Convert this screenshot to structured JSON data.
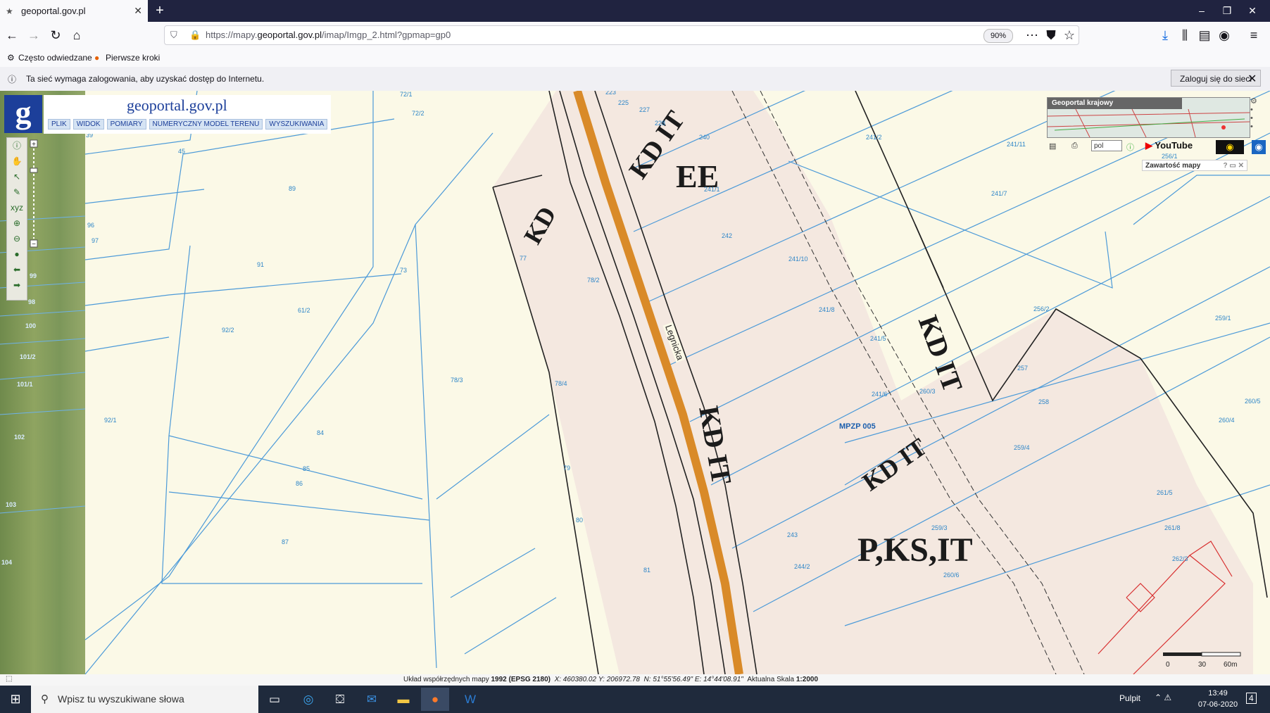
{
  "browser": {
    "tab_title": "geoportal.gov.pl",
    "url_prefix": "https://mapy.",
    "url_domain": "geoportal.gov.pl",
    "url_path": "/imap/Imgp_2.html?gpmap=gp0",
    "zoom": "90%",
    "bookmarks": [
      "Często odwiedzane",
      "Pierwsze kroki"
    ],
    "notification": "Ta sieć wymaga zalogowania, aby uzyskać dostęp do Internetu.",
    "login_button": "Zaloguj się do sieci"
  },
  "geoportal": {
    "brand": "geoportal.gov.pl",
    "logo_letter": "g",
    "menu": [
      "PLIK",
      "WIDOK",
      "POMIARY",
      "NUMERYCZNY MODEL TERENU",
      "WYSZUKIWANIA"
    ],
    "overview_title": "Geoportal krajowy",
    "language": "pol",
    "youtube": "YouTube",
    "map_contents": "Zawartość mapy",
    "mpzp_label": "MPZP 005",
    "zone_labels": [
      "EE",
      "KD IT",
      "KD",
      "KD IT",
      "KD IT",
      "P,KS,IT",
      "KD IT"
    ],
    "street_label": "Legnicka",
    "scale_labels": [
      "0",
      "30",
      "60m"
    ],
    "parcels_right": [
      "72/1",
      "72/2",
      "60",
      "45",
      "89",
      "39",
      "96",
      "97",
      "91",
      "92/2",
      "73",
      "61/2",
      "92/1",
      "84",
      "85",
      "86",
      "87",
      "77",
      "78/2",
      "78/3",
      "78/4",
      "79",
      "80",
      "81",
      "241/1",
      "241/2",
      "241/7",
      "241/11",
      "241/8",
      "241/10",
      "241/5",
      "241/6",
      "242",
      "256/1",
      "256/2",
      "257",
      "258",
      "259/1",
      "259/3",
      "259/4",
      "260/3",
      "260/4",
      "260/5",
      "260/6",
      "261/5",
      "261/8",
      "262/3",
      "243",
      "244/2",
      "240",
      "227",
      "228",
      "225",
      "223"
    ],
    "parcels_aerial": [
      "99",
      "98",
      "100",
      "101/2",
      "101/1",
      "102",
      "103",
      "104"
    ]
  },
  "status": {
    "coord_label": "Układ współrzędnych mapy",
    "crs": "1992 (EPSG 2180)",
    "x": "X: 460380.02",
    "y": "Y: 206972.78",
    "n": "N: 51°55'56.49\"",
    "e": "E: 14°44'08.91\"",
    "scale_label": "Aktualna Skala",
    "scale": "1:2000"
  },
  "taskbar": {
    "search_placeholder": "Wpisz tu wyszukiwane słowa",
    "pulpit": "Pulpit",
    "time": "13:49",
    "date": "07-06-2020",
    "notifications": "4"
  }
}
